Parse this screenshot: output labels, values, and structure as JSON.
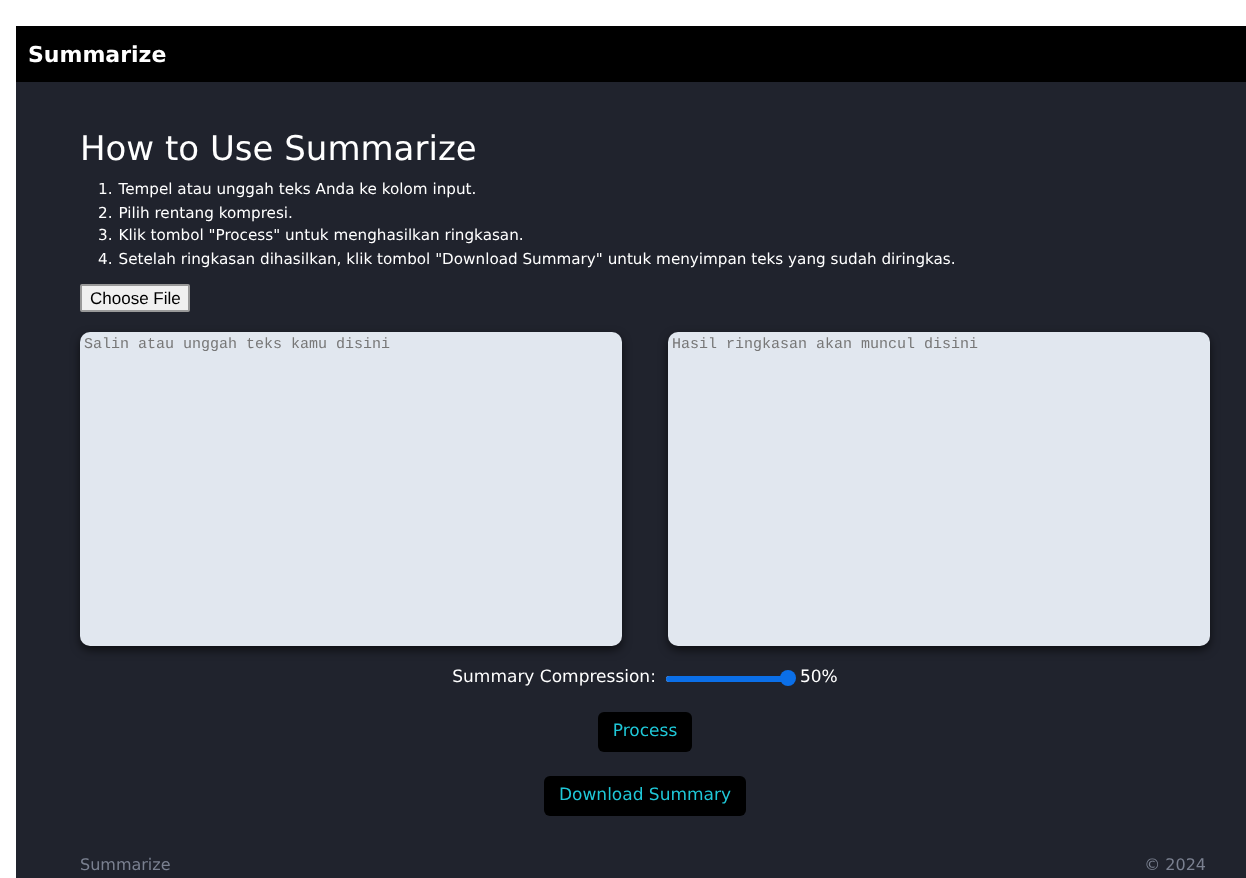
{
  "navbar": {
    "title": "Summarize"
  },
  "instructions": {
    "title": "How to Use Summarize",
    "steps": [
      {
        "number": "1.",
        "text": "Tempel atau unggah teks Anda ke kolom input."
      },
      {
        "number": "2.",
        "text": "Pilih rentang kompresi."
      },
      {
        "number": "3.",
        "text": "Klik tombol \"Process\" untuk menghasilkan ringkasan."
      },
      {
        "number": "4.",
        "text": "Setelah ringkasan dihasilkan, klik tombol \"Download Summary\" untuk menyimpan teks yang sudah diringkas."
      }
    ]
  },
  "file_button": "Choose File",
  "input": {
    "placeholder": "Salin atau unggah teks kamu disini"
  },
  "output": {
    "placeholder": "Hasil ringkasan akan muncul disini"
  },
  "compression": {
    "label": "Summary Compression:",
    "level": 1,
    "reading": "50%"
  },
  "buttons": [
    "Process",
    "Download Summary"
  ],
  "footer": {
    "left": "Summarize",
    "right": "© 2024"
  }
}
